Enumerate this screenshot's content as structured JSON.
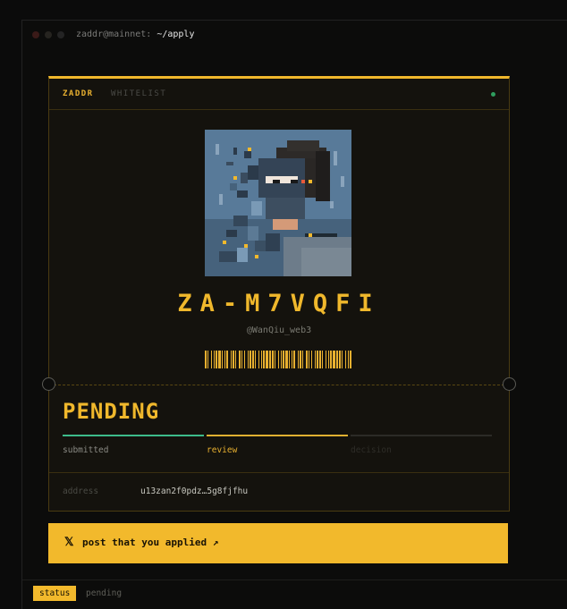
{
  "window": {
    "title_prefix": "zaddr@mainnet:",
    "title_path": "~/apply"
  },
  "card": {
    "brand": "ZADDR",
    "section": "WHITELIST",
    "token_id": "ZA-M7VQFI",
    "handle": "@WanQiu_web3",
    "status": "PENDING",
    "progress": {
      "steps": [
        "submitted",
        "review",
        "decision"
      ],
      "current_step": "review"
    },
    "address_label": "address",
    "address_value": "u13zan2f0pdz…5g8fjfhu"
  },
  "cta": {
    "icon": "x-logo-icon",
    "label": "post that you applied ↗"
  },
  "statusbar": {
    "tag": "status",
    "value": "pending"
  },
  "colors": {
    "accent": "#f0b82c",
    "done": "#3dbb8a",
    "live": "#2f9e5e"
  }
}
